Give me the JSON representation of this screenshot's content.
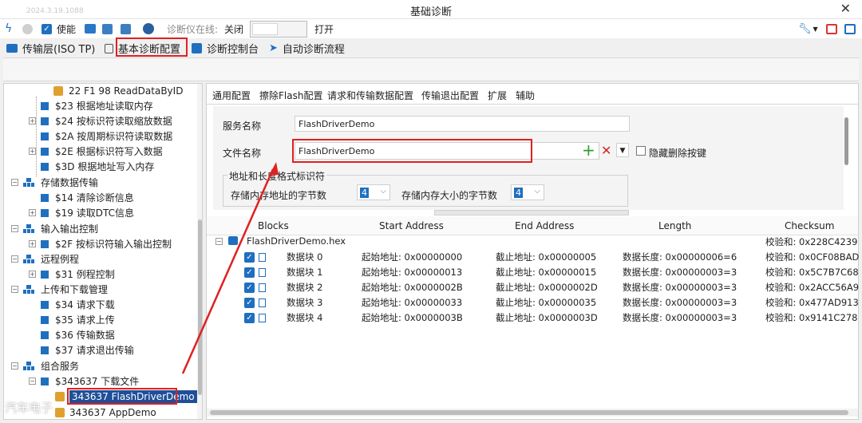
{
  "window": {
    "version": "2024.3.19.1088",
    "title": "基础诊断"
  },
  "toolbar": {
    "enable_label": "使能",
    "online_label": "诊断仪在线:",
    "off_label": "关闭",
    "on_label": "打开"
  },
  "tabs": [
    {
      "label": "传输层(ISO TP)"
    },
    {
      "label": "基本诊断配置"
    },
    {
      "label": "诊断控制台"
    },
    {
      "label": "自动诊断流程"
    }
  ],
  "tree": [
    {
      "label": "22 F1 98 ReadDataByID"
    },
    {
      "label": "$23 根据地址读取内存"
    },
    {
      "label": "$24 按标识符读取缩放数据"
    },
    {
      "label": "$2A 按周期标识符读取数据"
    },
    {
      "label": "$2E 根据标识符写入数据"
    },
    {
      "label": "$3D 根据地址写入内存"
    },
    {
      "label": "存储数据传输"
    },
    {
      "label": "$14 清除诊断信息"
    },
    {
      "label": "$19 读取DTC信息"
    },
    {
      "label": "输入输出控制"
    },
    {
      "label": "$2F 按标识符输入输出控制"
    },
    {
      "label": "远程例程"
    },
    {
      "label": "$31 例程控制"
    },
    {
      "label": "上传和下载管理"
    },
    {
      "label": "$34 请求下载"
    },
    {
      "label": "$35 请求上传"
    },
    {
      "label": "$36 传输数据"
    },
    {
      "label": "$37 请求退出传输"
    },
    {
      "label": "组合服务"
    },
    {
      "label": "$343637 下载文件"
    },
    {
      "label": "343637 FlashDriverDemo"
    },
    {
      "label": "343637 AppDemo"
    }
  ],
  "subtabs": [
    {
      "label": "通用配置"
    },
    {
      "label": "擦除Flash配置"
    },
    {
      "label": "请求和传输数据配置"
    },
    {
      "label": "传输退出配置"
    },
    {
      "label": "扩展"
    },
    {
      "label": "辅助"
    }
  ],
  "form": {
    "service_name_label": "服务名称",
    "service_name_value": "FlashDriverDemo",
    "file_name_label": "文件名称",
    "file_name_value": "FlashDriverDemo",
    "hide_delete_label": "隐藏删除按键",
    "group_label": "地址和长度格式标识符",
    "mem_addr_bytes_label": "存储内存地址的字节数",
    "mem_addr_bytes_value": "4",
    "mem_size_bytes_label": "存储内存大小的字节数",
    "mem_size_bytes_value": "4"
  },
  "grid": {
    "headers": [
      "Blocks",
      "Start Address",
      "End Address",
      "Length",
      "Checksum"
    ],
    "file": {
      "name": "FlashDriverDemo.hex",
      "checksum": "校验和: 0x228C4239"
    },
    "rows": [
      {
        "block": "数据块 0",
        "start": "起始地址: 0x00000000",
        "end": "截止地址: 0x00000005",
        "length": "数据长度: 0x00000006=6",
        "checksum": "校验和: 0x0CF08BAD"
      },
      {
        "block": "数据块 1",
        "start": "起始地址: 0x00000013",
        "end": "截止地址: 0x00000015",
        "length": "数据长度: 0x00000003=3",
        "checksum": "校验和: 0x5C7B7C68"
      },
      {
        "block": "数据块 2",
        "start": "起始地址: 0x0000002B",
        "end": "截止地址: 0x0000002D",
        "length": "数据长度: 0x00000003=3",
        "checksum": "校验和: 0x2ACC56A9"
      },
      {
        "block": "数据块 3",
        "start": "起始地址: 0x00000033",
        "end": "截止地址: 0x00000035",
        "length": "数据长度: 0x00000003=3",
        "checksum": "校验和: 0x477AD913"
      },
      {
        "block": "数据块 4",
        "start": "起始地址: 0x0000003B",
        "end": "截止地址: 0x0000003D",
        "length": "数据长度: 0x00000003=3",
        "checksum": "校验和: 0x9141C278"
      }
    ]
  },
  "watermark": "汽车电子",
  "colors": {
    "accent": "#1f6fbf",
    "highlight": "#e02020",
    "selected": "#1f4f99"
  }
}
